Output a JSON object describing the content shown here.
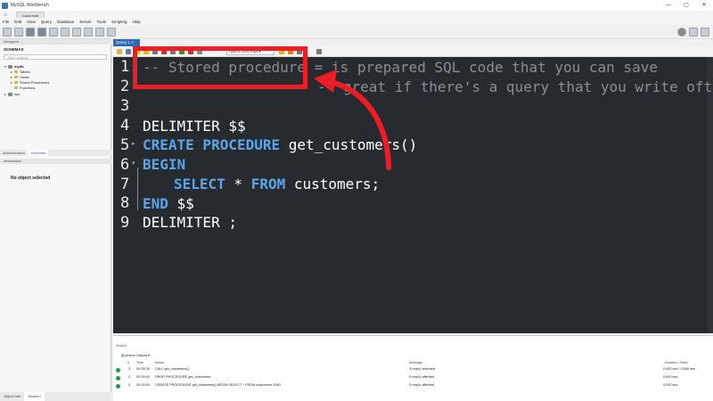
{
  "window": {
    "title": "MySQL Workbench",
    "controls": [
      "—",
      "▢",
      "✕"
    ]
  },
  "connection_tab": {
    "label": "Local host"
  },
  "menu": [
    "File",
    "Edit",
    "View",
    "Query",
    "Database",
    "Server",
    "Tools",
    "Scripting",
    "Help"
  ],
  "navigator": {
    "header": "Navigator",
    "schemas_title": "SCHEMAS",
    "filter_placeholder": "Filter objects",
    "tree": {
      "db1": "mydb",
      "tables": "Tables",
      "views": "Views",
      "procs": "Stored Procedures",
      "funcs": "Functions",
      "db2": "sys"
    },
    "tabs": [
      "Administration",
      "Schemas"
    ],
    "info_header": "Information",
    "no_object": "No object selected",
    "bottom_tabs": [
      "Object Info",
      "Session"
    ]
  },
  "query_tab": {
    "label": "Query 1"
  },
  "limit_select": {
    "value": "Limit to 1000 rows"
  },
  "editor": {
    "line_numbers": [
      "1",
      "2",
      "3",
      "4",
      "5",
      "6",
      "7",
      "8",
      "9"
    ],
    "line1": "-- Stored procedure = is prepared SQL code that you can save",
    "line2": "-- great if there's a query that you write often",
    "line4": "DELIMITER $$",
    "line5_kw": "CREATE PROCEDURE",
    "line5_rest": " get_customers()",
    "line6_kw": "BEGIN",
    "line7_kw1": "SELECT",
    "line7_mid": " * ",
    "line7_kw2": "FROM",
    "line7_rest": " customers;",
    "line8_kw": "END",
    "line8_rest": " $$",
    "line9": "DELIMITER ;"
  },
  "output": {
    "title": "Output",
    "selector": "Action Output",
    "headers": {
      "num": "#",
      "time": "Time",
      "action": "Action",
      "message": "Message",
      "duration": "Duration / Fetch"
    },
    "rows": [
      {
        "num": "3",
        "time": "00:25:25",
        "action": "CALL get_customers()",
        "message": "3 row(s) returned",
        "duration": "0.000 sec / 0.000 sec"
      },
      {
        "num": "2",
        "time": "00:25:45",
        "action": "DROP PROCEDURE get_customers",
        "message": "0 row(s) affected",
        "duration": "0.000 sec"
      },
      {
        "num": "4",
        "time": "00:25:45",
        "action": "CREATE PROCEDURE get_customers() BEGIN SELECT * FROM customers; END",
        "message": "0 row(s) affected",
        "duration": "0.000 sec"
      }
    ]
  },
  "colors": {
    "editor_bg": "#272b30",
    "keyword": "#5aa6e8",
    "comment": "#8a8d91",
    "highlight_box": "#ee1c25",
    "query_tab": "#2e6bb5"
  }
}
